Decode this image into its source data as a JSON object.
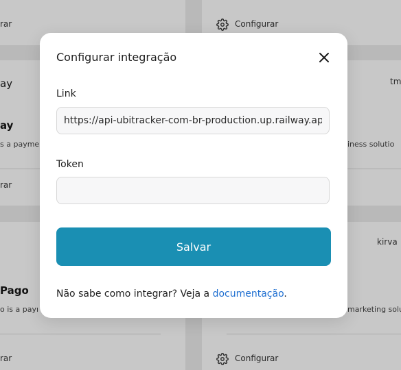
{
  "background": {
    "configure_label": "Configurar",
    "configure_label_cut": "rar",
    "cards": {
      "left_top_short": "ay",
      "left_mid_title": "ay",
      "left_mid_desc": "s a payme",
      "left_bottom_title": "Pago",
      "left_bottom_desc": "o is a payı",
      "right_mid_tag": "tm",
      "right_mid_desc": "iness solutio",
      "right_bottom_tag": "kirva",
      "right_bottom_desc": "marketing solu"
    }
  },
  "modal": {
    "title": "Configurar integração",
    "link_label": "Link",
    "link_value": "https://api-ubitracker-com-br-production.up.railway.ap",
    "token_label": "Token",
    "token_value": "",
    "save_label": "Salvar",
    "help_text": "Não sabe como integrar? Veja a ",
    "help_link": "documentação",
    "help_end": "."
  },
  "colors": {
    "primary": "#1a8fb3",
    "link": "#1f6fd1",
    "overlay": "#b9b9b9"
  }
}
